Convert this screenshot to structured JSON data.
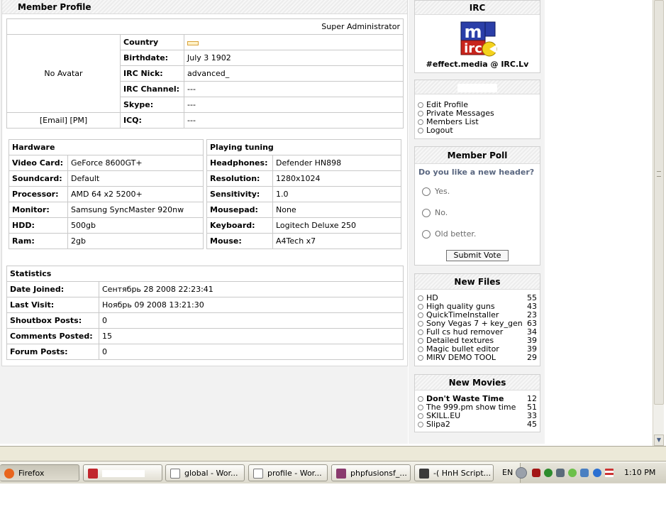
{
  "profile": {
    "caption": "Member Profile",
    "role": "Super Administrator",
    "avatar": "No Avatar",
    "contact_links": "[Email] [PM]",
    "rows": [
      {
        "label": "Country",
        "value": ""
      },
      {
        "label": "Birthdate:",
        "value": "July 3 1902"
      },
      {
        "label": "IRC Nick:",
        "value": "advanced_"
      },
      {
        "label": "IRC Channel:",
        "value": "---"
      },
      {
        "label": "Skype:",
        "value": "---"
      },
      {
        "label": "ICQ:",
        "value": "---"
      }
    ]
  },
  "hardware": {
    "title": "Hardware",
    "rows": [
      {
        "label": "Video Card:",
        "value": "GeForce 8600GT+"
      },
      {
        "label": "Soundcard:",
        "value": "Default"
      },
      {
        "label": "Processor:",
        "value": "AMD 64 x2 5200+"
      },
      {
        "label": "Monitor:",
        "value": "Samsung SyncMaster 920nw"
      },
      {
        "label": "HDD:",
        "value": "500gb"
      },
      {
        "label": "Ram:",
        "value": "2gb"
      }
    ]
  },
  "tuning": {
    "title": "Playing tuning",
    "rows": [
      {
        "label": "Headphones:",
        "value": "Defender HN898"
      },
      {
        "label": "Resolution:",
        "value": "1280x1024"
      },
      {
        "label": "Sensitivity:",
        "value": "1.0"
      },
      {
        "label": "Mousepad:",
        "value": "None"
      },
      {
        "label": "Keyboard:",
        "value": "Logitech Deluxe 250"
      },
      {
        "label": "Mouse:",
        "value": "A4Tech x7"
      }
    ]
  },
  "statistics": {
    "title": "Statistics",
    "rows": [
      {
        "label": "Date Joined:",
        "value": "Сентябрь 28 2008 22:23:41"
      },
      {
        "label": "Last Visit:",
        "value": "Ноябрь 09 2008 13:21:30"
      },
      {
        "label": "Shoutbox Posts:",
        "value": "0"
      },
      {
        "label": "Comments Posted:",
        "value": "15"
      },
      {
        "label": "Forum Posts:",
        "value": "0"
      }
    ]
  },
  "irc": {
    "caption": "IRC",
    "logo_text": "mIRC",
    "channel": "#effect.media @ IRC.Lv"
  },
  "user_menu": {
    "items": [
      "Edit Profile",
      "Private Messages",
      "Members List",
      "Logout"
    ]
  },
  "poll": {
    "caption": "Member Poll",
    "question": "Do you like a new header?",
    "options": [
      "Yes.",
      "No.",
      "Old better."
    ],
    "submit": "Submit Vote"
  },
  "new_files": {
    "caption": "New Files",
    "items": [
      {
        "name": "HD",
        "count": "55"
      },
      {
        "name": "High quality guns",
        "count": "43"
      },
      {
        "name": "QuickTimeInstaller",
        "count": "23"
      },
      {
        "name": "Sony Vegas 7 + key_gen",
        "count": "63"
      },
      {
        "name": "Full cs hud remover",
        "count": "34"
      },
      {
        "name": "Detailed textures",
        "count": "39"
      },
      {
        "name": "Magic bullet editor",
        "count": "39"
      },
      {
        "name": "MIRV DEMO TOOL",
        "count": "29"
      }
    ]
  },
  "new_movies": {
    "caption": "New Movies",
    "items": [
      {
        "name": "Don't Waste Time",
        "count": "12"
      },
      {
        "name": "The 999.pm show time",
        "count": "51"
      },
      {
        "name": "SKILL.EU",
        "count": "33"
      },
      {
        "name": "Slipa2",
        "count": "45"
      }
    ]
  },
  "taskbar": {
    "buttons": [
      {
        "label": "Firefox",
        "color": "#e8651d"
      },
      {
        "label": "",
        "color": "#c1272d"
      },
      {
        "label": "global - Wor...",
        "color": "#9c9c9c"
      },
      {
        "label": "profile - Wor...",
        "color": "#9c9c9c"
      },
      {
        "label": "phpfusionsf_...",
        "color": "#8a3b6e"
      },
      {
        "label": "-( HnH Script...",
        "color": "#3a3a3a"
      }
    ],
    "lang": "EN",
    "clock": "1:10 PM"
  }
}
